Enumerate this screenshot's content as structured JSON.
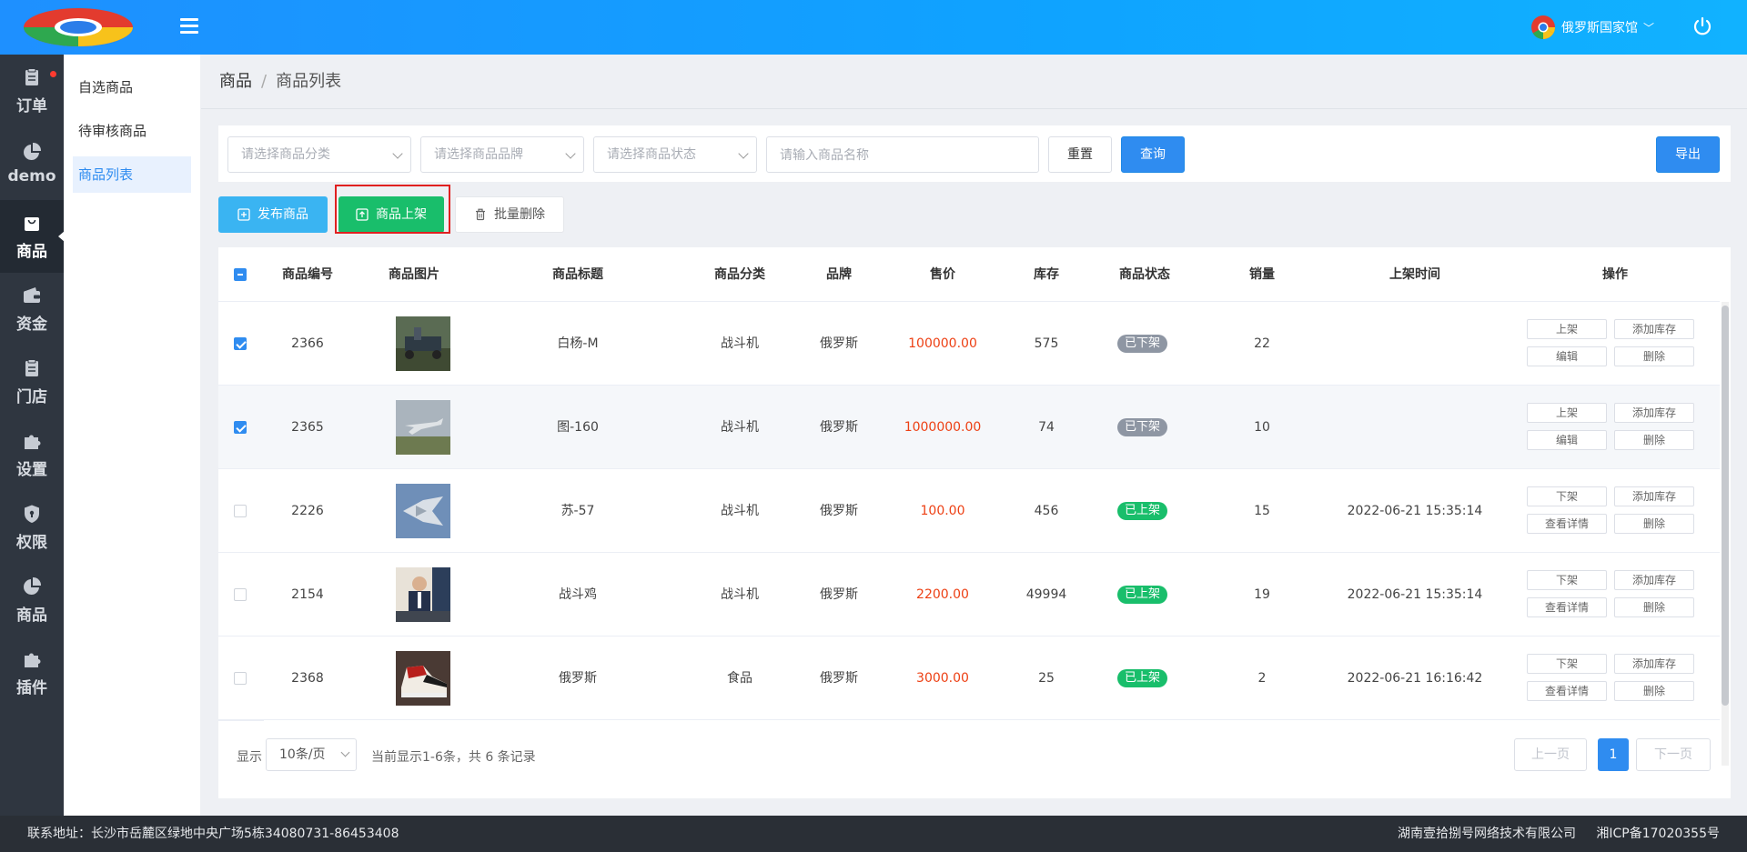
{
  "topbar": {
    "user_name": "俄罗斯国家馆",
    "icons": {
      "menu": "hamburger-icon",
      "power": "power-icon",
      "logo": "browser-logo",
      "avatar": "browser-logo-avatar"
    }
  },
  "leftnav": [
    {
      "label": "订单",
      "icon": "clipboard-icon",
      "badge": true
    },
    {
      "label": "demo",
      "icon": "pie-chart-icon"
    },
    {
      "label": "商品",
      "icon": "shopping-bag-icon",
      "active": true
    },
    {
      "label": "资金",
      "icon": "wallet-icon"
    },
    {
      "label": "门店",
      "icon": "clipboard-icon"
    },
    {
      "label": "设置",
      "icon": "puzzle-icon"
    },
    {
      "label": "权限",
      "icon": "shield-icon"
    },
    {
      "label": "商品",
      "icon": "pie-chart-icon"
    },
    {
      "label": "插件",
      "icon": "puzzle-icon"
    }
  ],
  "subnav": [
    {
      "label": "自选商品"
    },
    {
      "label": "待审核商品"
    },
    {
      "label": "商品列表",
      "active": true
    }
  ],
  "breadcrumb": {
    "root": "商品",
    "sep": "/",
    "current": "商品列表"
  },
  "filter": {
    "category_placeholder": "请选择商品分类",
    "brand_placeholder": "请选择商品品牌",
    "status_placeholder": "请选择商品状态",
    "name_placeholder": "请输入商品名称",
    "reset": "重置",
    "query": "查询",
    "export": "导出"
  },
  "actions": {
    "publish": "发布商品",
    "shelve": "商品上架",
    "batch_delete": "批量删除"
  },
  "table": {
    "columns": [
      "商品编号",
      "商品图片",
      "商品标题",
      "商品分类",
      "品牌",
      "售价",
      "库存",
      "商品状态",
      "销量",
      "上架时间",
      "操作"
    ],
    "rows": [
      {
        "id": "2366",
        "title": "白杨-M",
        "category": "战斗机",
        "brand": "俄罗斯",
        "price": "100000.00",
        "stock": "575",
        "status": "已下架",
        "status_type": "off",
        "sales": "22",
        "time": "",
        "checked": true,
        "ops": [
          "上架",
          "添加库存",
          "编辑",
          "删除"
        ]
      },
      {
        "id": "2365",
        "title": "图-160",
        "category": "战斗机",
        "brand": "俄罗斯",
        "price": "1000000.00",
        "stock": "74",
        "status": "已下架",
        "status_type": "off",
        "sales": "10",
        "time": "",
        "checked": true,
        "ops": [
          "上架",
          "添加库存",
          "编辑",
          "删除"
        ]
      },
      {
        "id": "2226",
        "title": "苏-57",
        "category": "战斗机",
        "brand": "俄罗斯",
        "price": "100.00",
        "stock": "456",
        "status": "已上架",
        "status_type": "on",
        "sales": "15",
        "time": "2022-06-21 15:35:14",
        "checked": false,
        "ops": [
          "下架",
          "添加库存",
          "查看详情",
          "删除"
        ]
      },
      {
        "id": "2154",
        "title": "战斗鸡",
        "category": "战斗机",
        "brand": "俄罗斯",
        "price": "2200.00",
        "stock": "49994",
        "status": "已上架",
        "status_type": "on",
        "sales": "19",
        "time": "2022-06-21 15:35:14",
        "checked": false,
        "ops": [
          "下架",
          "添加库存",
          "查看详情",
          "删除"
        ]
      },
      {
        "id": "2368",
        "title": "俄罗斯",
        "category": "食品",
        "brand": "俄罗斯",
        "price": "3000.00",
        "stock": "25",
        "status": "已上架",
        "status_type": "on",
        "sales": "2",
        "time": "2022-06-21 16:16:42",
        "checked": false,
        "ops": [
          "下架",
          "添加库存",
          "查看详情",
          "删除"
        ]
      }
    ]
  },
  "pagination": {
    "show_label": "显示",
    "page_size": "10条/页",
    "summary": "当前显示1-6条，共 6 条记录",
    "prev": "上一页",
    "current": "1",
    "next": "下一页"
  },
  "footer": {
    "address": "联系地址：长沙市岳麓区绿地中央广场5栋34080731-86453408",
    "company": "湖南壹拾捌号网络技术有限公司",
    "icp": "湘ICP备17020355号"
  },
  "colors": {
    "primary": "#2f8cf0",
    "success": "#19be6b",
    "danger": "#ed4014",
    "nav_bg": "#2f3640"
  }
}
